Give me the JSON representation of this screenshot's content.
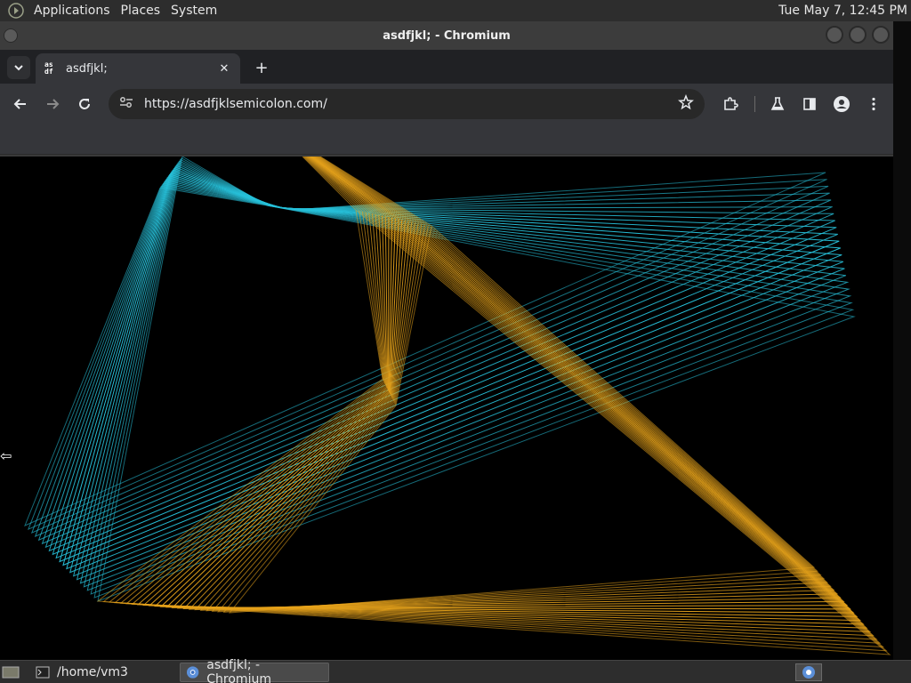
{
  "top_panel": {
    "menus": [
      "Applications",
      "Places",
      "System"
    ],
    "clock": "Tue May  7, 12:45 PM"
  },
  "window": {
    "title": "asdfjkl; - Chromium"
  },
  "tab": {
    "favicon_text_top": "as",
    "favicon_text_bottom": "df",
    "title": "asdfjkl;",
    "close_glyph": "✕",
    "new_tab_glyph": "+"
  },
  "toolbar": {
    "url": "https://asdfjklsemicolon.com/"
  },
  "taskbar": {
    "items": [
      "/home/vm3",
      "asdfjkl; - Chromium"
    ]
  },
  "colors": {
    "cyan": "#27c1da",
    "gold": "#e6a21b",
    "panel": "#2d2d2d",
    "chrome_dark": "#202124",
    "chrome_toolbar": "#35363a"
  }
}
